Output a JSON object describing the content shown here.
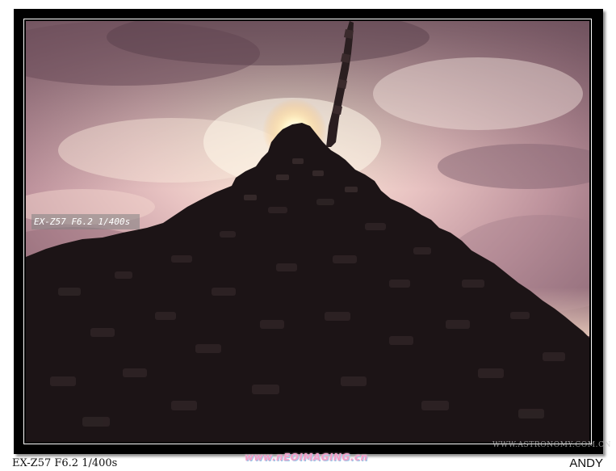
{
  "photo": {
    "subject": "stone-cairn-silhouette-with-sun",
    "exif_overlay": "EX-Z57 F6.2 1/400s"
  },
  "caption": {
    "exif": "EX-Z57 F6.2 1/400s",
    "author": "ANDY"
  },
  "watermarks": {
    "center": "www.nEOIMAGING.cn",
    "right": "WWW.ASTRONOMY.COM.CN"
  },
  "colors": {
    "frame": "#000000",
    "sky_top": "#7a5a66",
    "sky_glow": "#fff4dc",
    "silhouette": "#1c1416",
    "sun": "#ffffff"
  }
}
